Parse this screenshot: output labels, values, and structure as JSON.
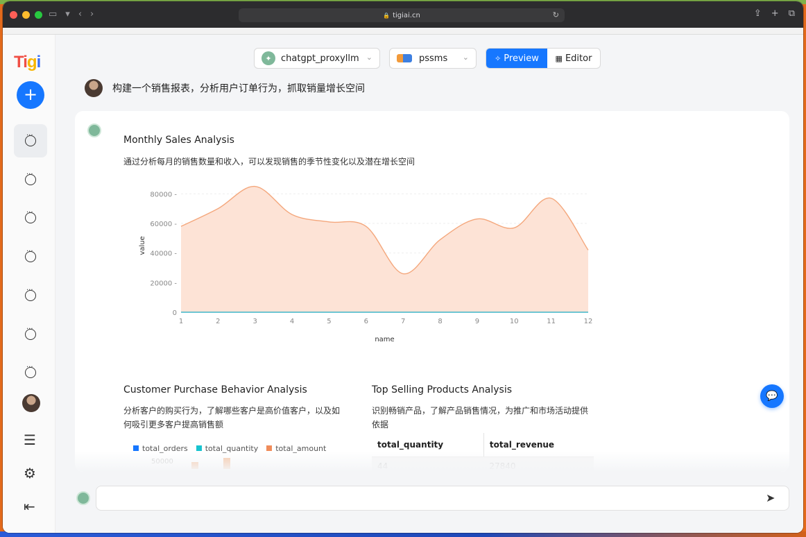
{
  "browser": {
    "url": "tigiai.cn",
    "toolbar_icons": [
      "sidebar-icon",
      "back-icon",
      "forward-icon",
      "share-icon",
      "new-tab-icon",
      "tabs-icon"
    ]
  },
  "app": {
    "logo": [
      "Ti",
      "g",
      "i"
    ],
    "sidebar": {
      "items": [
        "chat-1",
        "chat-2",
        "chat-3",
        "chat-4",
        "chat-5",
        "chat-6",
        "chat-7"
      ],
      "bottom_icons": [
        "menu-icon",
        "gear-icon",
        "collapse-icon"
      ]
    },
    "topbar": {
      "model": "chatgpt_proxyllm",
      "database": "pssms",
      "preview_label": "Preview",
      "editor_label": "Editor"
    },
    "user_message": "构建一个销售报表，分析用户订单行为，抓取销量增长空间",
    "answer": {
      "chart1": {
        "title": "Monthly Sales Analysis",
        "subtitle": "通过分析每月的销售数量和收入，可以发现销售的季节性变化以及潜在增长空间"
      },
      "section2": {
        "title": "Customer Purchase Behavior Analysis",
        "text": "分析客户的购买行为，了解哪些客户是高价值客户，以及如何吸引更多客户提高销售额",
        "legend": [
          "total_orders",
          "total_quantity",
          "total_amount"
        ],
        "axis_tick": "50000"
      },
      "section3": {
        "title": "Top Selling Products Analysis",
        "text": "识别畅销产品，了解产品销售情况，为推广和市场活动提供依据",
        "table_headers": [
          "total_quantity",
          "total_revenue"
        ],
        "table_row": [
          "44",
          "27840"
        ]
      }
    },
    "input_placeholder": ""
  },
  "colors": {
    "accent": "#1677ff",
    "area_fill": "#fde3d6",
    "area_line": "#f4a77c",
    "zero_line": "#3fb6c9"
  },
  "chart_data": {
    "type": "area",
    "x": [
      1,
      2,
      3,
      4,
      5,
      6,
      7,
      8,
      9,
      10,
      11,
      12
    ],
    "series": [
      {
        "values": [
          58000,
          70000,
          85000,
          66000,
          61000,
          58000,
          26000,
          49000,
          63000,
          57000,
          77000,
          42000
        ]
      },
      {
        "values": [
          0,
          0,
          0,
          0,
          0,
          0,
          0,
          0,
          0,
          0,
          0,
          0
        ]
      }
    ],
    "xlabel": "name",
    "ylabel": "value",
    "yticks": [
      0,
      20000,
      40000,
      60000,
      80000
    ],
    "ylim": [
      0,
      90000
    ],
    "grid": true
  }
}
